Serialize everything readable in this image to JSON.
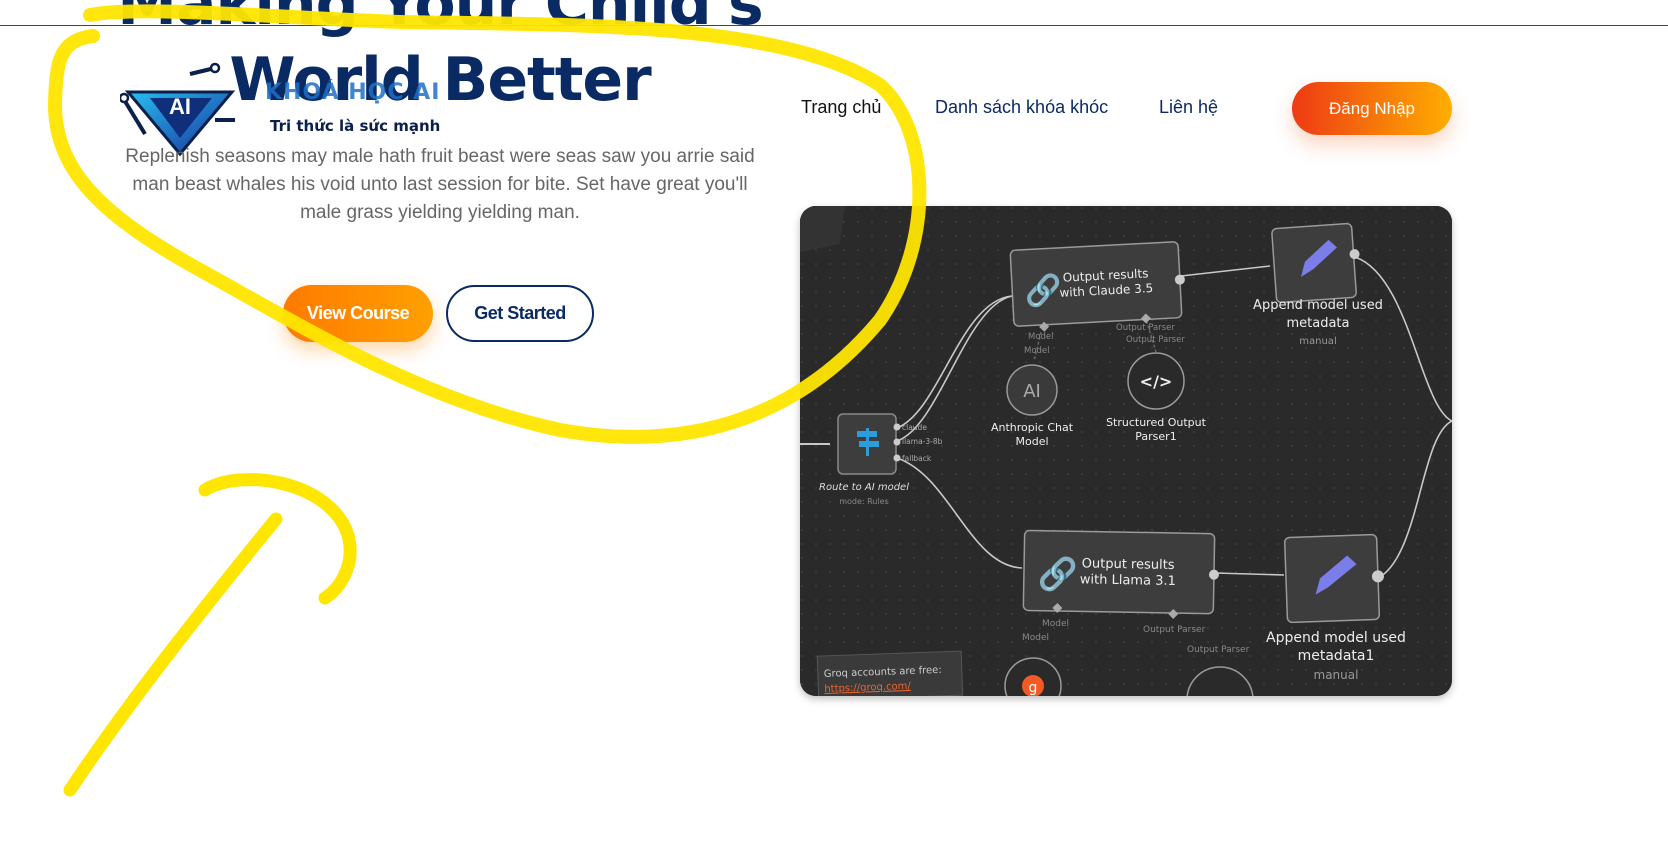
{
  "hero": {
    "title_line1": "Making Your Child's",
    "title_line2": "World Better",
    "description": "Replenish seasons may male hath fruit beast were seas saw you arrie said man beast whales his void unto last session for bite. Set have great you'll male grass yielding yielding man.",
    "view_course_label": "View Course",
    "get_started_label": "Get Started"
  },
  "brand": {
    "logo_text": "AI",
    "name": "KHOÁ HỌC AI",
    "tagline": "Tri thức là sức mạnh"
  },
  "nav": {
    "items": [
      {
        "label": "Trang chủ"
      },
      {
        "label": "Danh sách khóa khóc"
      },
      {
        "label": "Liên hệ"
      }
    ],
    "login_label": "Đăng Nhập"
  },
  "workflow": {
    "router": {
      "title": "Route to AI model",
      "subtitle": "mode: Rules",
      "outputs": [
        "claude",
        "llama-3-8b",
        "fallback"
      ]
    },
    "claude_node": {
      "label_line1": "Output results",
      "label_line2": "with Claude 3.5",
      "port_model": "Model",
      "port_parser": "Output Parser"
    },
    "append1": {
      "label_line1": "Append model used",
      "label_line2": "metadata",
      "sub": "manual"
    },
    "anthropic": {
      "label_line1": "Anthropic Chat",
      "label_line2": "Model",
      "port": "Model"
    },
    "parser1": {
      "label_line1": "Structured Output",
      "label_line2": "Parser1",
      "port": "Output Parser"
    },
    "llama_node": {
      "label_line1": "Output results",
      "label_line2": "with Llama 3.1",
      "port_model": "Model",
      "port_parser": "Output Parser"
    },
    "append2": {
      "label_line1": "Append model used",
      "label_line2": "metadata1",
      "sub": "manual"
    },
    "groq_sub_model": "Model",
    "groq_sub_parser": "Output Parser",
    "note_line1": "Groq accounts are free:",
    "note_line2": "https://groq.com/"
  },
  "colors": {
    "navy": "#0a2a63",
    "orange": "#ff8a00",
    "login_start": "#ee3a14",
    "login_end": "#ffae00",
    "highlighter": "#ffe600",
    "canvas": "#2a2a2a"
  }
}
